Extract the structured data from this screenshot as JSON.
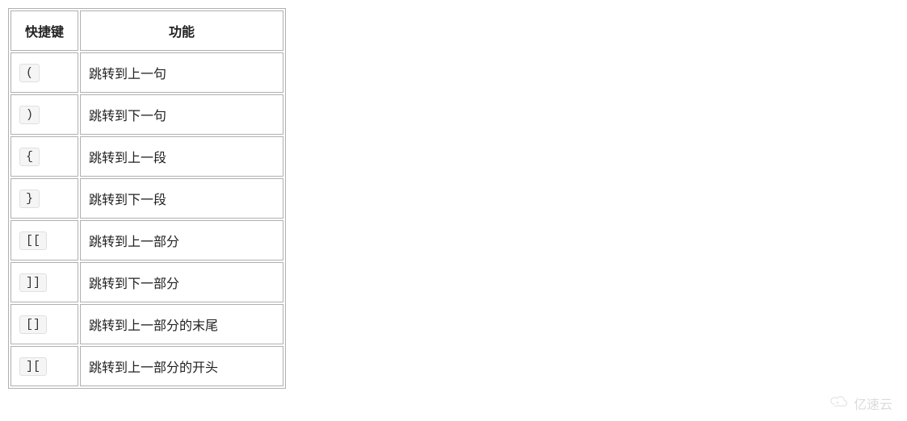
{
  "table": {
    "headers": {
      "shortcut": "快捷键",
      "function": "功能"
    },
    "rows": [
      {
        "key": "(",
        "func": "跳转到上一句"
      },
      {
        "key": ")",
        "func": "跳转到下一句"
      },
      {
        "key": "{",
        "func": "跳转到上一段"
      },
      {
        "key": "}",
        "func": "跳转到下一段"
      },
      {
        "key": "[[",
        "func": "跳转到上一部分"
      },
      {
        "key": "]]",
        "func": "跳转到下一部分"
      },
      {
        "key": "[]",
        "func": "跳转到上一部分的末尾"
      },
      {
        "key": "][",
        "func": "跳转到上一部分的开头"
      }
    ]
  },
  "watermark": {
    "text": "亿速云"
  }
}
